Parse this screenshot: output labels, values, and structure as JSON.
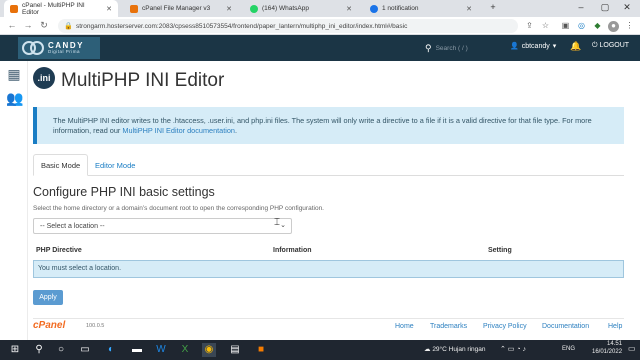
{
  "browser": {
    "tabs": [
      {
        "title": "cPanel - MultiPHP INI Editor",
        "active": true,
        "color": "#e8710a"
      },
      {
        "title": "cPanel File Manager v3",
        "active": false,
        "color": "#e8710a"
      },
      {
        "title": "(164) WhatsApp",
        "active": false,
        "color": "#25d366"
      },
      {
        "title": "1 notification",
        "active": false,
        "color": "#1a73e8"
      }
    ],
    "url": "strongarm.hosterserver.com:2083/cpsess8510573554/frontend/paper_lantern/multiphp_ini_editor/index.html#/basic"
  },
  "header": {
    "logo_name": "CANDY",
    "logo_tagline": "Digital Prima",
    "search_placeholder": "Search ( / )",
    "username": "cbtcandy",
    "logout": "LOGOUT"
  },
  "page": {
    "icon_text": ".ini",
    "title": "MultiPHP INI Editor",
    "info_text": "The MultiPHP INI editor writes to the .htaccess, .user.ini, and php.ini files. The system will only write a directive to a file if it is a valid directive for that file type. For more information, read our",
    "info_link": "MultiPHP INI Editor documentation",
    "info_end": ".",
    "tabs": [
      "Basic Mode",
      "Editor Mode"
    ],
    "heading": "Configure PHP INI basic settings",
    "subtext": "Select the home directory or a domain’s document root to open the corresponding PHP configuration.",
    "select_value": "-- Select a location --",
    "columns": [
      "PHP Directive",
      "Information",
      "Setting"
    ],
    "message": "You must select a location.",
    "apply": "Apply"
  },
  "footer": {
    "logo": "cPanel",
    "version": "100.0.5",
    "links": [
      "Home",
      "Trademarks",
      "Privacy Policy",
      "Documentation",
      "Help"
    ]
  },
  "taskbar": {
    "weather": "29°C  Hujan ringan",
    "lang": "ENG",
    "time": "14.51",
    "date": "16/01/2022"
  },
  "colors": {
    "cpanel_bar": "#1b3545",
    "accent": "#1a7dc4",
    "info_bg": "#d6ecf7",
    "cpanel_orange": "#f26c22"
  }
}
